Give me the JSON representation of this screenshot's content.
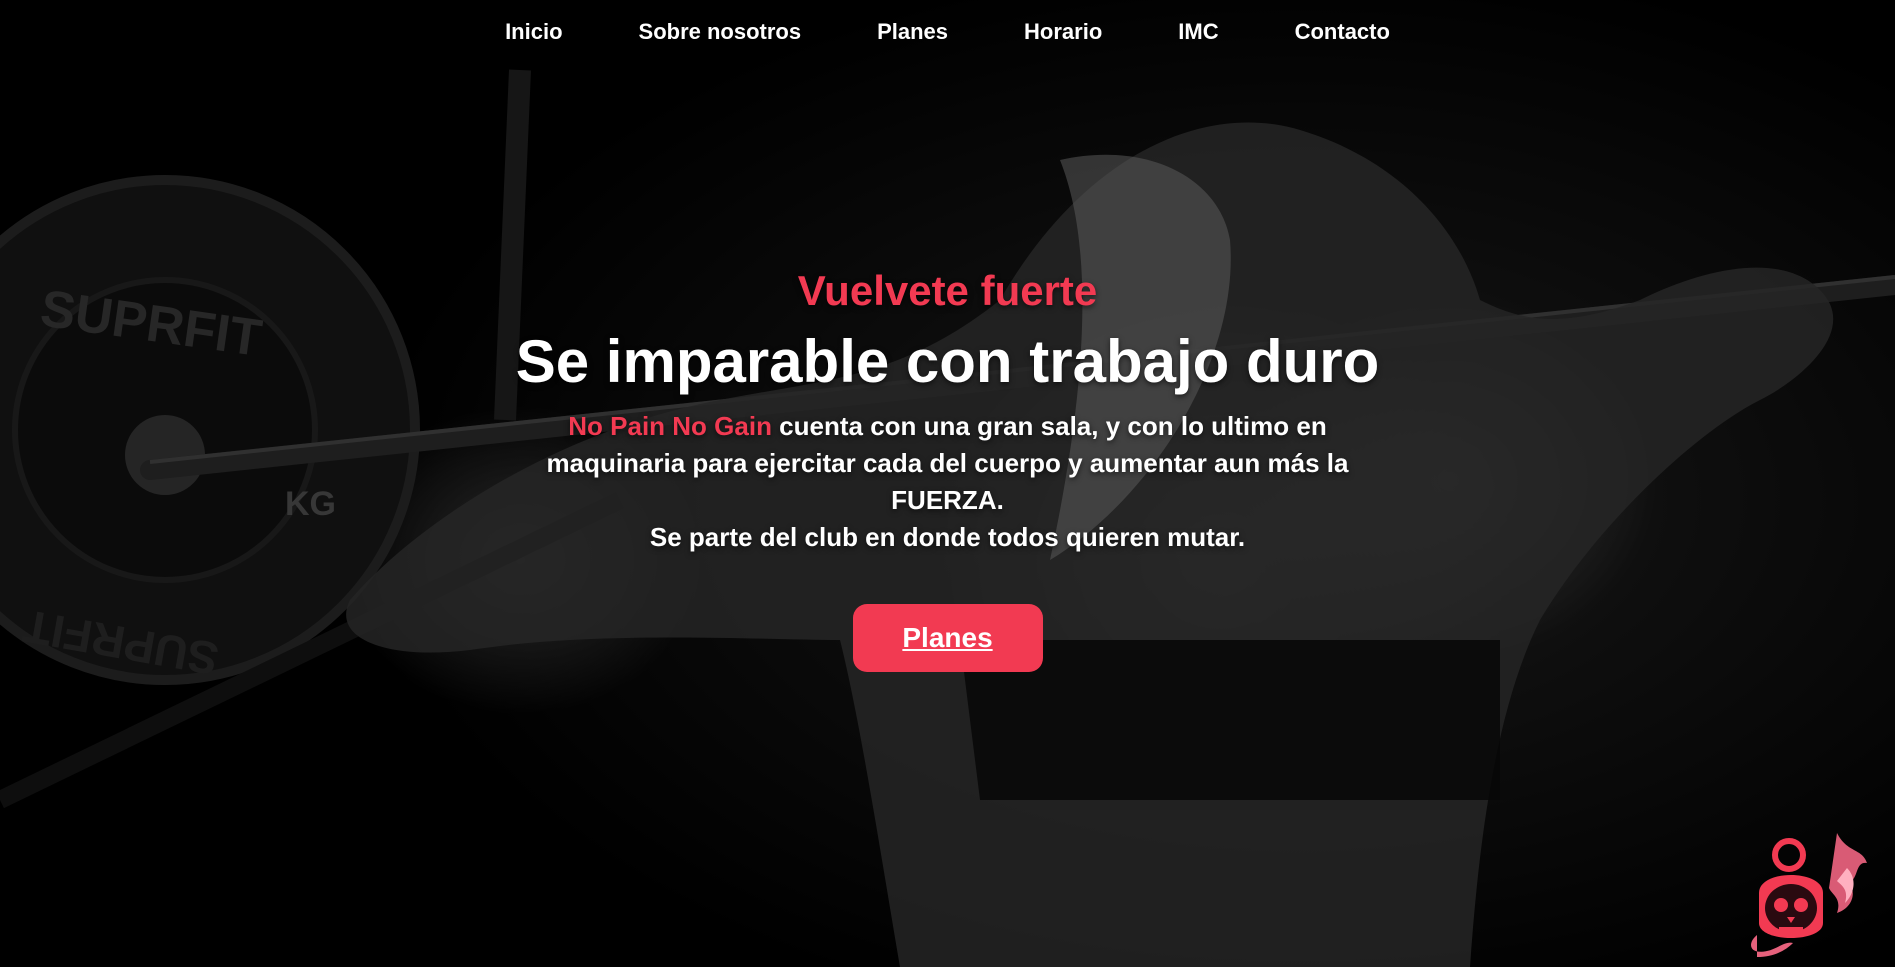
{
  "nav": {
    "items": [
      "Inicio",
      "Sobre nosotros",
      "Planes",
      "Horario",
      "IMC",
      "Contacto"
    ]
  },
  "hero": {
    "eyebrow": "Vuelvete fuerte",
    "headline": "Se imparable con trabajo duro",
    "brand": "No Pain No Gain",
    "description_rest": " cuenta con una gran sala, y con lo ultimo en maquinaria para ejercitar cada del cuerpo y aumentar aun más la FUERZA.",
    "description_line2": "Se parte del club en donde todos quieren mutar.",
    "cta_label": "Planes"
  },
  "colors": {
    "accent": "#f23a52",
    "background": "#000000",
    "text": "#ffffff"
  },
  "background_image": {
    "plate_text_top": "SUPRFIT",
    "plate_text_bottom": "SUPRFIT",
    "plate_unit": "KG"
  },
  "icons": {
    "logo": "skull-kettlebell-flame-icon"
  }
}
